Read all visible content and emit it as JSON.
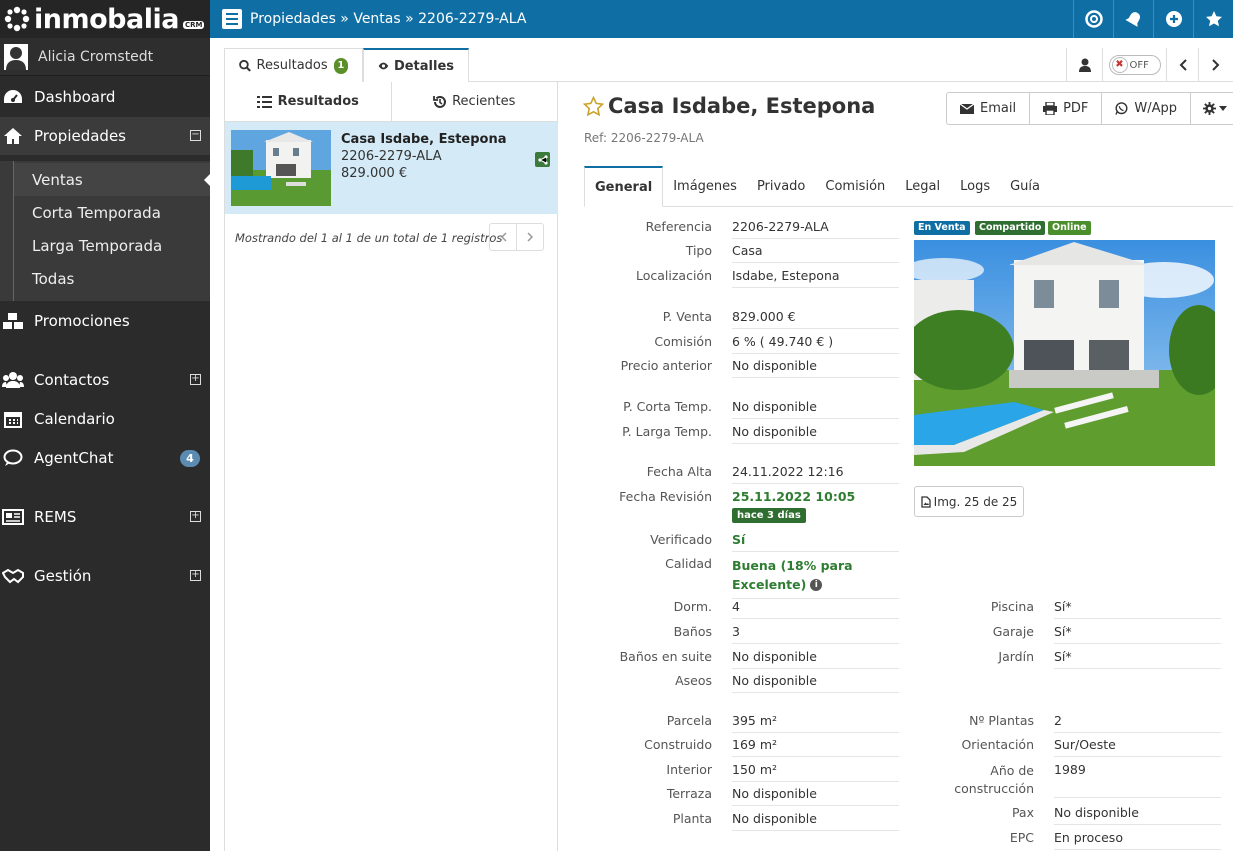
{
  "app": {
    "logo_text": "inmobalia",
    "logo_badge": "CRM"
  },
  "user": {
    "name": "Alicia Cromstedt"
  },
  "sidebar": {
    "items": [
      {
        "label": "Dashboard",
        "icon": "dashboard-icon"
      },
      {
        "label": "Propiedades",
        "icon": "home-icon",
        "toggle": "minus"
      },
      {
        "label": "Promociones",
        "icon": "cubes-icon"
      },
      {
        "label": "Contactos",
        "icon": "users-icon",
        "toggle": "plus"
      },
      {
        "label": "Calendario",
        "icon": "calendar-icon"
      },
      {
        "label": "AgentChat",
        "icon": "chat-icon",
        "badge": "4"
      },
      {
        "label": "REMS",
        "icon": "newspaper-icon",
        "toggle": "plus"
      },
      {
        "label": "Gestión",
        "icon": "handshake-icon",
        "toggle": "plus"
      }
    ],
    "subitems": [
      "Ventas",
      "Corta Temporada",
      "Larga Temporada",
      "Todas"
    ]
  },
  "topbar": {
    "breadcrumb": "Propiedades » Ventas » 2206-2279-ALA"
  },
  "tabs": {
    "resultados": "Resultados",
    "resultados_count": "1",
    "detalles": "Detalles",
    "toggle": "OFF"
  },
  "results": {
    "subtab_resultados": "Resultados",
    "subtab_recientes": "Recientes",
    "card": {
      "title": "Casa Isdabe, Estepona",
      "ref": "2206-2279-ALA",
      "price": "829.000 €"
    },
    "pagination": "Mostrando del 1 al 1 de un total de 1 registros"
  },
  "property": {
    "title": "Casa Isdabe, Estepona",
    "ref": "Ref: 2206-2279-ALA",
    "actions": {
      "email": "Email",
      "pdf": "PDF",
      "wapp": "W/App"
    },
    "tabs": [
      "General",
      "Imágenes",
      "Privado",
      "Comisión",
      "Legal",
      "Logs",
      "Guía"
    ],
    "tags": [
      {
        "label": "En Venta",
        "color": "#0f6fa4"
      },
      {
        "label": "Compartido",
        "color": "#2f6e30"
      },
      {
        "label": "Online",
        "color": "#4a8f2c"
      }
    ],
    "img_counter": "Img. 25 de 25",
    "fields": {
      "referencia": {
        "label": "Referencia",
        "value": "2206-2279-ALA"
      },
      "tipo": {
        "label": "Tipo",
        "value": "Casa"
      },
      "localizacion": {
        "label": "Localización",
        "value": "Isdabe, Estepona"
      },
      "p_venta": {
        "label": "P. Venta",
        "value": "829.000 €"
      },
      "comision": {
        "label": "Comisión",
        "value": "6 % ( 49.740 € )"
      },
      "precio_anterior": {
        "label": "Precio anterior",
        "value": "No disponible"
      },
      "p_corta": {
        "label": "P. Corta Temp.",
        "value": "No disponible"
      },
      "p_larga": {
        "label": "P. Larga Temp.",
        "value": "No disponible"
      },
      "fecha_alta": {
        "label": "Fecha Alta",
        "value": "24.11.2022 12:16"
      },
      "fecha_revision": {
        "label": "Fecha Revisión",
        "value": "25.11.2022 10:05",
        "badge": "hace 3 días"
      },
      "verificado": {
        "label": "Verificado",
        "value": "Sí"
      },
      "calidad": {
        "label": "Calidad",
        "value_line1": "Buena (18% para",
        "value_line2": "Excelente)"
      },
      "dorm": {
        "label": "Dorm.",
        "value": "4"
      },
      "banos": {
        "label": "Baños",
        "value": "3"
      },
      "banos_suite": {
        "label": "Baños en suite",
        "value": "No disponible"
      },
      "aseos": {
        "label": "Aseos",
        "value": "No disponible"
      },
      "parcela": {
        "label": "Parcela",
        "value": "395 m²"
      },
      "construido": {
        "label": "Construido",
        "value": "169 m²"
      },
      "interior": {
        "label": "Interior",
        "value": "150 m²"
      },
      "terraza": {
        "label": "Terraza",
        "value": "No disponible"
      },
      "planta": {
        "label": "Planta",
        "value": "No disponible"
      },
      "piscina": {
        "label": "Piscina",
        "value": "Sí*"
      },
      "garaje": {
        "label": "Garaje",
        "value": "Sí*"
      },
      "jardin": {
        "label": "Jardín",
        "value": "Sí*"
      },
      "n_plantas": {
        "label": "Nº Plantas",
        "value": "2"
      },
      "orientacion": {
        "label": "Orientación",
        "value": "Sur/Oeste"
      },
      "ano_construccion": {
        "label_line1": "Año de",
        "label_line2": "construcción",
        "value": "1989"
      },
      "pax": {
        "label": "Pax",
        "value": "No disponible"
      },
      "epc": {
        "label": "EPC",
        "value": "En proceso"
      }
    }
  },
  "colors": {
    "topbar": "#0f6fa4",
    "sidebar": "#2b2b2b",
    "selected_result": "#d4ebf7",
    "green": "#2e7d32"
  }
}
